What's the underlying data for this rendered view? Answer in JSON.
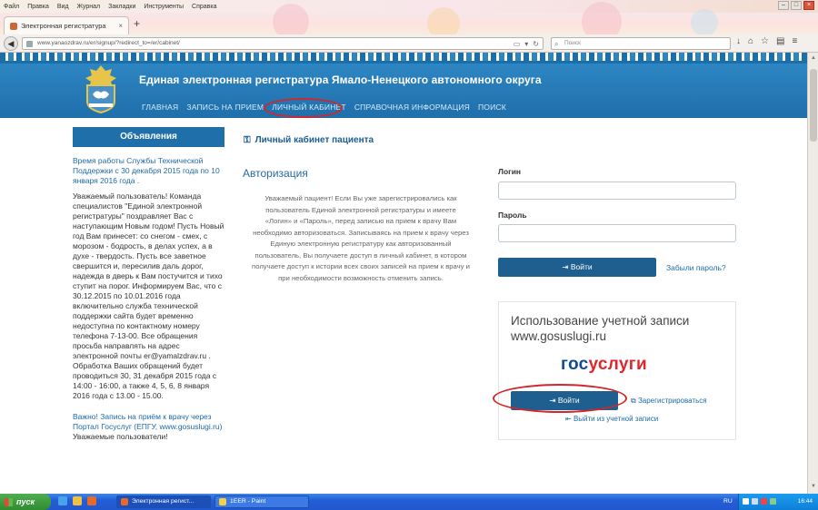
{
  "browser": {
    "menu": [
      "Файл",
      "Правка",
      "Вид",
      "Журнал",
      "Закладки",
      "Инструменты",
      "Справка"
    ],
    "tab_title": "Электронная регистратура",
    "url": "www.yanaozdrav.ru/er/signup/?redirect_to=/er/cabinet/",
    "search_placeholder": "Поиск"
  },
  "site": {
    "title": "Единая электронная регистратура Ямало-Ненецкого автономного округа",
    "nav": [
      "ГЛАВНАЯ",
      "ЗАПИСЬ НА ПРИЕМ",
      "ЛИЧНЫЙ КАБИНЕТ",
      "СПРАВОЧНАЯ ИНФОРМАЦИЯ",
      "ПОИСК"
    ]
  },
  "sidebar": {
    "heading": "Объявления",
    "item1_title": "Время работы Службы Технической Поддержки с 30 декабря 2015 года по 10 января 2016 года .",
    "item1_text": "Уважаемый пользователь! Команда специалистов \"Единой электронной регистратуры\" поздравляет Вас с наступающим Новым годом! Пусть Новый год Вам принесет: со снегом - смех, с морозом - бодрость, в делах успех, а в духе - твердость. Пусть все заветное свершится и, пересилив даль дорог, надежда в дверь к Вам постучится и тихо ступит на порог. Информируем Вас, что с 30.12.2015 по 10.01.2016 года включительно служба технической поддержки сайта будет временно недоступна по контактному номеру телефона 7-13-00. Все обращения просьба направлять на адрес электронной почты er@yamalzdrav.ru . Обработка Ваших обращений будет проводиться 30, 31 декабря 2015 года с 14:00 - 16:00, а также 4, 5, 6, 8 января 2016 года с 13.00 - 15.00.",
    "item2_title": "Важно! Запись на приём к врачу через Портал Госуслуг (ЕПГУ, www.gosuslugi.ru)",
    "item2_text": "Уважаемые пользователи!"
  },
  "main": {
    "breadcrumb": "Личный кабинет пациента",
    "auth_heading": "Авторизация",
    "auth_text": "Уважаемый пациент! Если Вы уже зарегистрировались как пользователь Единой электронной регистратуры и имеете «Логин» и «Пароль», перед записью на прием к врачу Вам необходимо авторизоваться. Записываясь на прием к врачу через Единую электронную регистратуру как авторизованный пользователь, Вы получаете доступ в личный кабинет, в котором получаете доступ к истории всех своих записей на прием к врачу и при необходимости возможность отменить запись.",
    "login_label": "Логин",
    "password_label": "Пароль",
    "login_value": "",
    "password_value": "",
    "login_button": "Войти",
    "forgot": "Забыли пароль?",
    "gos_title": "Использование учетной записи www.gosuslugi.ru",
    "gos_logo_part1": "гос",
    "gos_logo_part2": "услуги",
    "gos_button": "Войти",
    "register": "Зарегистрироваться",
    "logout": "Выйти из учетной записи"
  },
  "taskbar": {
    "start": "пуск",
    "tasks": [
      "Электронная регист...",
      "1EER - Paint"
    ],
    "lang": "RU",
    "time": "16:44"
  },
  "colors": {
    "accent": "#1f6fab",
    "button": "#1f5f8f",
    "highlight": "#d3262a"
  }
}
